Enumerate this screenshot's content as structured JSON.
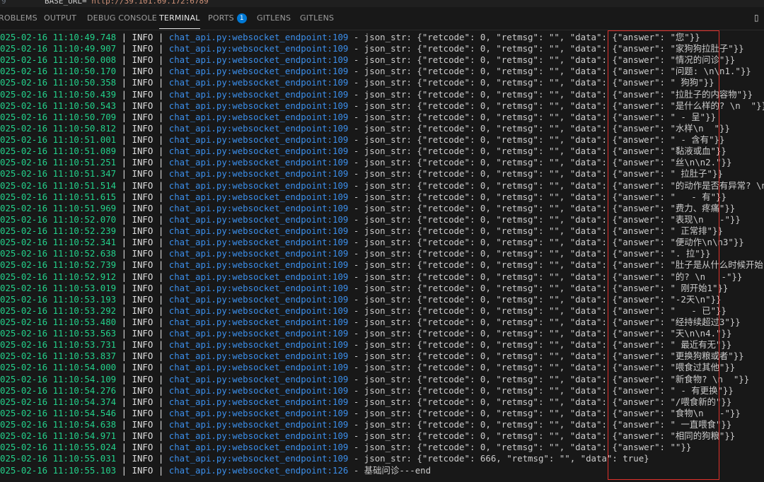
{
  "editor": {
    "line_number": "9",
    "code_prefix": "BASE_URL=",
    "code_string": "\"http://39.101.69.172:6789\""
  },
  "panel": {
    "tabs": [
      "ROBLEMS",
      "OUTPUT",
      "DEBUG CONSOLE",
      "TERMINAL",
      "PORTS",
      "GITLENS",
      "GITLENS"
    ],
    "ports_badge": "1",
    "active_tab": "TERMINAL",
    "layout_icon": "split-icon"
  },
  "colors": {
    "timestamp": "#23d18b",
    "location": "#3b8eea",
    "highlight_box": "#e0312c"
  },
  "terminal": {
    "lines": [
      {
        "ts": "025-02-16 11:10:49.748",
        "level": "INFO",
        "loc": "chat_api.py:websocket_endpoint:109",
        "msg": "json_str: {\"retcode\": 0, \"retmsg\": \"\", \"data\": {\"answer\": \"您\"}}"
      },
      {
        "ts": "025-02-16 11:10:49.907",
        "level": "INFO",
        "loc": "chat_api.py:websocket_endpoint:109",
        "msg": "json_str: {\"retcode\": 0, \"retmsg\": \"\", \"data\": {\"answer\": \"家狗狗拉肚子\"}}"
      },
      {
        "ts": "025-02-16 11:10:50.008",
        "level": "INFO",
        "loc": "chat_api.py:websocket_endpoint:109",
        "msg": "json_str: {\"retcode\": 0, \"retmsg\": \"\", \"data\": {\"answer\": \"情况的问诊\"}}"
      },
      {
        "ts": "025-02-16 11:10:50.170",
        "level": "INFO",
        "loc": "chat_api.py:websocket_endpoint:109",
        "msg": "json_str: {\"retcode\": 0, \"retmsg\": \"\", \"data\": {\"answer\": \"问题: \\n\\n1.\"}}"
      },
      {
        "ts": "025-02-16 11:10:50.358",
        "level": "INFO",
        "loc": "chat_api.py:websocket_endpoint:109",
        "msg": "json_str: {\"retcode\": 0, \"retmsg\": \"\", \"data\": {\"answer\": \" 狗狗\"}}"
      },
      {
        "ts": "025-02-16 11:10:50.439",
        "level": "INFO",
        "loc": "chat_api.py:websocket_endpoint:109",
        "msg": "json_str: {\"retcode\": 0, \"retmsg\": \"\", \"data\": {\"answer\": \"拉肚子的内容物\"}}"
      },
      {
        "ts": "025-02-16 11:10:50.543",
        "level": "INFO",
        "loc": "chat_api.py:websocket_endpoint:109",
        "msg": "json_str: {\"retcode\": 0, \"retmsg\": \"\", \"data\": {\"answer\": \"是什么样的? \\n  \"}}"
      },
      {
        "ts": "025-02-16 11:10:50.709",
        "level": "INFO",
        "loc": "chat_api.py:websocket_endpoint:109",
        "msg": "json_str: {\"retcode\": 0, \"retmsg\": \"\", \"data\": {\"answer\": \" - 呈\"}}"
      },
      {
        "ts": "025-02-16 11:10:50.812",
        "level": "INFO",
        "loc": "chat_api.py:websocket_endpoint:109",
        "msg": "json_str: {\"retcode\": 0, \"retmsg\": \"\", \"data\": {\"answer\": \"水样\\n  \"}}"
      },
      {
        "ts": "025-02-16 11:10:51.001",
        "level": "INFO",
        "loc": "chat_api.py:websocket_endpoint:109",
        "msg": "json_str: {\"retcode\": 0, \"retmsg\": \"\", \"data\": {\"answer\": \" - 含有\"}}"
      },
      {
        "ts": "025-02-16 11:10:51.089",
        "level": "INFO",
        "loc": "chat_api.py:websocket_endpoint:109",
        "msg": "json_str: {\"retcode\": 0, \"retmsg\": \"\", \"data\": {\"answer\": \"黏液或血\"}}"
      },
      {
        "ts": "025-02-16 11:10:51.251",
        "level": "INFO",
        "loc": "chat_api.py:websocket_endpoint:109",
        "msg": "json_str: {\"retcode\": 0, \"retmsg\": \"\", \"data\": {\"answer\": \"丝\\n\\n2.\"}}"
      },
      {
        "ts": "025-02-16 11:10:51.347",
        "level": "INFO",
        "loc": "chat_api.py:websocket_endpoint:109",
        "msg": "json_str: {\"retcode\": 0, \"retmsg\": \"\", \"data\": {\"answer\": \" 拉肚子\"}}"
      },
      {
        "ts": "025-02-16 11:10:51.514",
        "level": "INFO",
        "loc": "chat_api.py:websocket_endpoint:109",
        "msg": "json_str: {\"retcode\": 0, \"retmsg\": \"\", \"data\": {\"answer\": \"的动作是否有异常? \\n\"}}"
      },
      {
        "ts": "025-02-16 11:10:51.615",
        "level": "INFO",
        "loc": "chat_api.py:websocket_endpoint:109",
        "msg": "json_str: {\"retcode\": 0, \"retmsg\": \"\", \"data\": {\"answer\": \"   - 有\"}}"
      },
      {
        "ts": "025-02-16 11:10:51.969",
        "level": "INFO",
        "loc": "chat_api.py:websocket_endpoint:109",
        "msg": "json_str: {\"retcode\": 0, \"retmsg\": \"\", \"data\": {\"answer\": \"费力、疼痛\"}}"
      },
      {
        "ts": "025-02-16 11:10:52.070",
        "level": "INFO",
        "loc": "chat_api.py:websocket_endpoint:109",
        "msg": "json_str: {\"retcode\": 0, \"retmsg\": \"\", \"data\": {\"answer\": \"表现\\n   -\"}}"
      },
      {
        "ts": "025-02-16 11:10:52.239",
        "level": "INFO",
        "loc": "chat_api.py:websocket_endpoint:109",
        "msg": "json_str: {\"retcode\": 0, \"retmsg\": \"\", \"data\": {\"answer\": \" 正常排\"}}"
      },
      {
        "ts": "025-02-16 11:10:52.341",
        "level": "INFO",
        "loc": "chat_api.py:websocket_endpoint:109",
        "msg": "json_str: {\"retcode\": 0, \"retmsg\": \"\", \"data\": {\"answer\": \"便动作\\n\\n3\"}}"
      },
      {
        "ts": "025-02-16 11:10:52.638",
        "level": "INFO",
        "loc": "chat_api.py:websocket_endpoint:109",
        "msg": "json_str: {\"retcode\": 0, \"retmsg\": \"\", \"data\": {\"answer\": \". 拉\"}}"
      },
      {
        "ts": "025-02-16 11:10:52.739",
        "level": "INFO",
        "loc": "chat_api.py:websocket_endpoint:109",
        "msg": "json_str: {\"retcode\": 0, \"retmsg\": \"\", \"data\": {\"answer\": \"肚子是从什么时候开始\"}}"
      },
      {
        "ts": "025-02-16 11:10:52.912",
        "level": "INFO",
        "loc": "chat_api.py:websocket_endpoint:109",
        "msg": "json_str: {\"retcode\": 0, \"retmsg\": \"\", \"data\": {\"answer\": \"的? \\n   -\"}}"
      },
      {
        "ts": "025-02-16 11:10:53.019",
        "level": "INFO",
        "loc": "chat_api.py:websocket_endpoint:109",
        "msg": "json_str: {\"retcode\": 0, \"retmsg\": \"\", \"data\": {\"answer\": \" 刚开始1\"}}"
      },
      {
        "ts": "025-02-16 11:10:53.193",
        "level": "INFO",
        "loc": "chat_api.py:websocket_endpoint:109",
        "msg": "json_str: {\"retcode\": 0, \"retmsg\": \"\", \"data\": {\"answer\": \"-2天\\n\"}}"
      },
      {
        "ts": "025-02-16 11:10:53.292",
        "level": "INFO",
        "loc": "chat_api.py:websocket_endpoint:109",
        "msg": "json_str: {\"retcode\": 0, \"retmsg\": \"\", \"data\": {\"answer\": \"   - 已\"}}"
      },
      {
        "ts": "025-02-16 11:10:53.480",
        "level": "INFO",
        "loc": "chat_api.py:websocket_endpoint:109",
        "msg": "json_str: {\"retcode\": 0, \"retmsg\": \"\", \"data\": {\"answer\": \"经持续超过3\"}}"
      },
      {
        "ts": "025-02-16 11:10:53.563",
        "level": "INFO",
        "loc": "chat_api.py:websocket_endpoint:109",
        "msg": "json_str: {\"retcode\": 0, \"retmsg\": \"\", \"data\": {\"answer\": \"天\\n\\n4.\"}}"
      },
      {
        "ts": "025-02-16 11:10:53.731",
        "level": "INFO",
        "loc": "chat_api.py:websocket_endpoint:109",
        "msg": "json_str: {\"retcode\": 0, \"retmsg\": \"\", \"data\": {\"answer\": \" 最近有无\"}}"
      },
      {
        "ts": "025-02-16 11:10:53.837",
        "level": "INFO",
        "loc": "chat_api.py:websocket_endpoint:109",
        "msg": "json_str: {\"retcode\": 0, \"retmsg\": \"\", \"data\": {\"answer\": \"更换狗粮或者\"}}"
      },
      {
        "ts": "025-02-16 11:10:54.000",
        "level": "INFO",
        "loc": "chat_api.py:websocket_endpoint:109",
        "msg": "json_str: {\"retcode\": 0, \"retmsg\": \"\", \"data\": {\"answer\": \"喂食过其他\"}}"
      },
      {
        "ts": "025-02-16 11:10:54.109",
        "level": "INFO",
        "loc": "chat_api.py:websocket_endpoint:109",
        "msg": "json_str: {\"retcode\": 0, \"retmsg\": \"\", \"data\": {\"answer\": \"新食物? \\n  \"}}"
      },
      {
        "ts": "025-02-16 11:10:54.276",
        "level": "INFO",
        "loc": "chat_api.py:websocket_endpoint:109",
        "msg": "json_str: {\"retcode\": 0, \"retmsg\": \"\", \"data\": {\"answer\": \" - 有更换\"}}"
      },
      {
        "ts": "025-02-16 11:10:54.374",
        "level": "INFO",
        "loc": "chat_api.py:websocket_endpoint:109",
        "msg": "json_str: {\"retcode\": 0, \"retmsg\": \"\", \"data\": {\"answer\": \"/喂食新的\"}}"
      },
      {
        "ts": "025-02-16 11:10:54.546",
        "level": "INFO",
        "loc": "chat_api.py:websocket_endpoint:109",
        "msg": "json_str: {\"retcode\": 0, \"retmsg\": \"\", \"data\": {\"answer\": \"食物\\n   -\"}}"
      },
      {
        "ts": "025-02-16 11:10:54.638",
        "level": "INFO",
        "loc": "chat_api.py:websocket_endpoint:109",
        "msg": "json_str: {\"retcode\": 0, \"retmsg\": \"\", \"data\": {\"answer\": \" 一直喂食\"}}"
      },
      {
        "ts": "025-02-16 11:10:54.971",
        "level": "INFO",
        "loc": "chat_api.py:websocket_endpoint:109",
        "msg": "json_str: {\"retcode\": 0, \"retmsg\": \"\", \"data\": {\"answer\": \"相同的狗粮\"}}"
      },
      {
        "ts": "025-02-16 11:10:55.024",
        "level": "INFO",
        "loc": "chat_api.py:websocket_endpoint:109",
        "msg": "json_str: {\"retcode\": 0, \"retmsg\": \"\", \"data\": {\"answer\": \"\"}}"
      },
      {
        "ts": "025-02-16 11:10:55.031",
        "level": "INFO",
        "loc": "chat_api.py:websocket_endpoint:109",
        "msg": "json_str: {\"retcode\": 666, \"retmsg\": \"\", \"data\": true}"
      },
      {
        "ts": "025-02-16 11:10:55.103",
        "level": "INFO",
        "loc": "chat_api.py:websocket_endpoint:126",
        "msg": "基础问诊---end"
      }
    ]
  }
}
